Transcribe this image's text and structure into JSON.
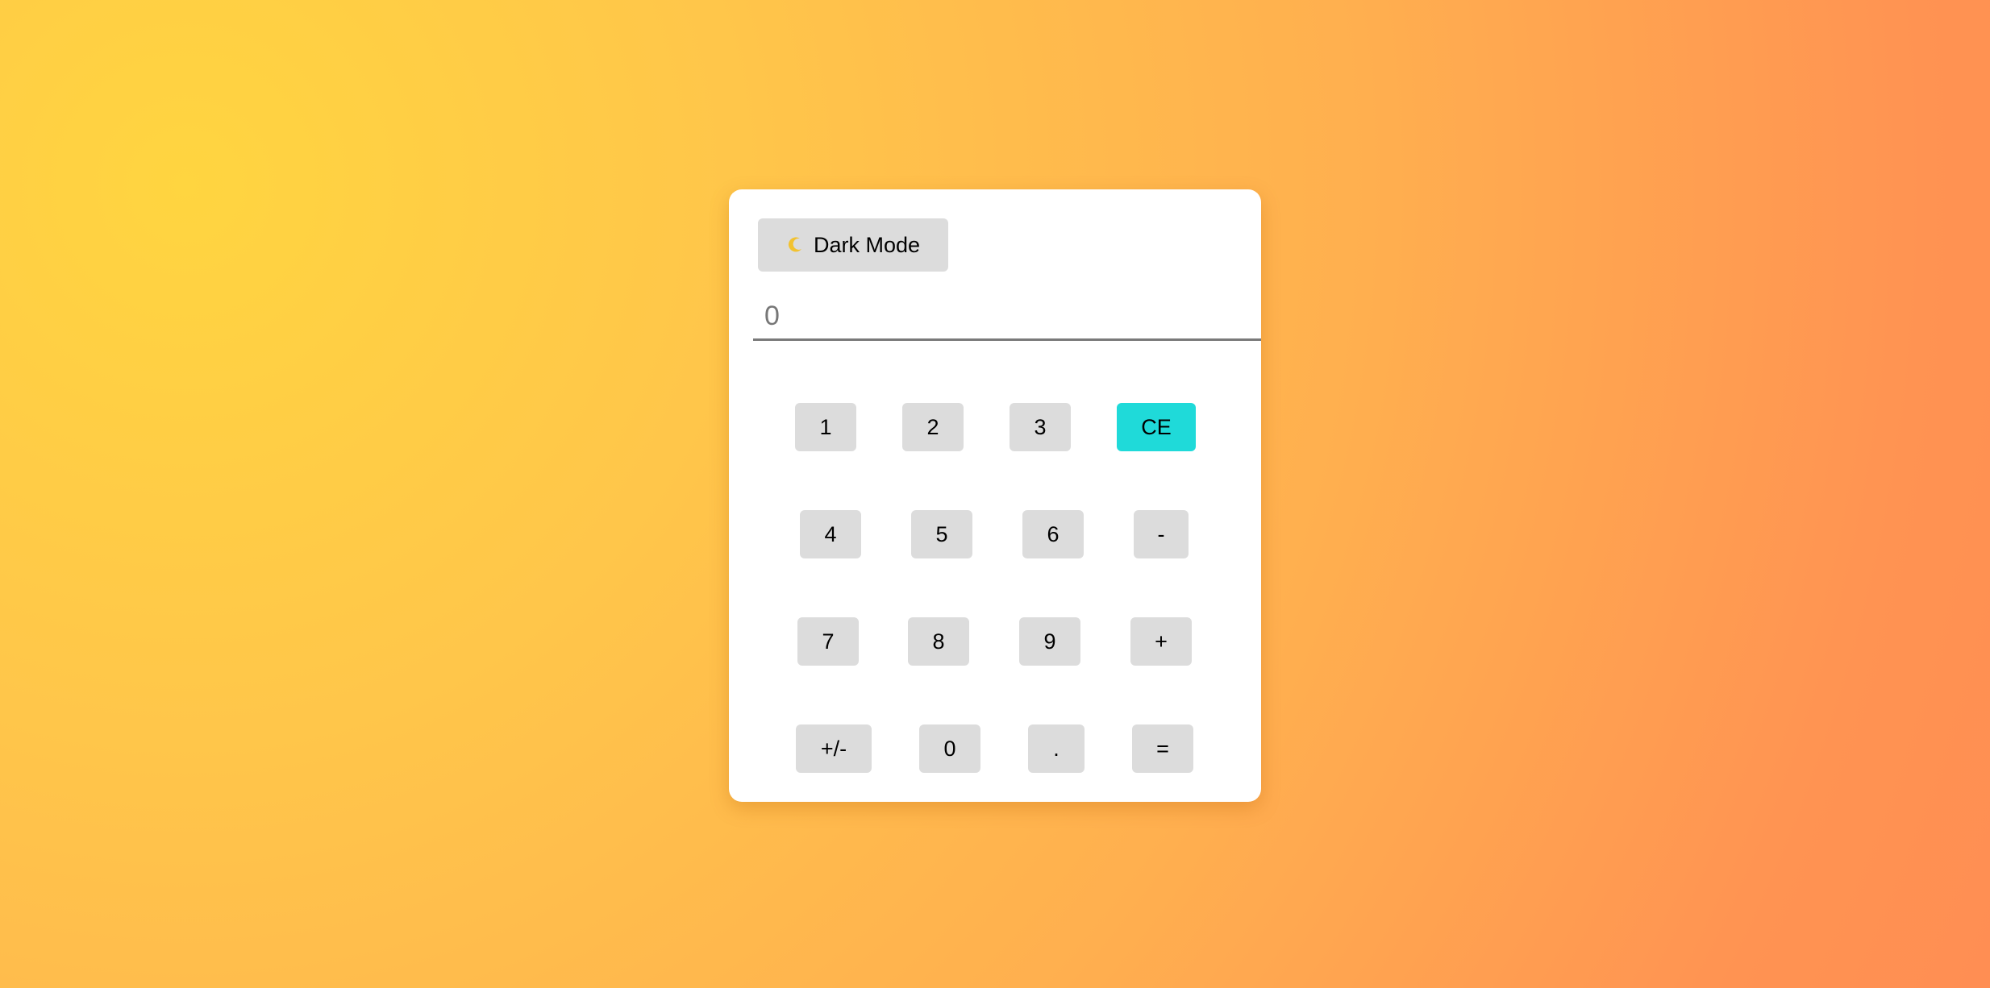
{
  "toolbar": {
    "mode_label": "Dark Mode",
    "mode_icon": "moon-icon"
  },
  "display": {
    "value": "",
    "placeholder": "0"
  },
  "keypad": {
    "rows": [
      [
        "1",
        "2",
        "3",
        "CE"
      ],
      [
        "4",
        "5",
        "6",
        "-"
      ],
      [
        "7",
        "8",
        "9",
        "+"
      ],
      [
        "+/-",
        "0",
        ".",
        "="
      ]
    ]
  },
  "colors": {
    "background_start": "#ffd540",
    "background_end": "#ff8e53",
    "key": "#dcdcdc",
    "clear_key": "#1fdad9",
    "card": "#ffffff"
  }
}
